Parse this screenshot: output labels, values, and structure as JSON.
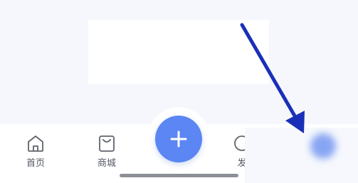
{
  "tabs": [
    {
      "label": "首页",
      "icon": "home-icon"
    },
    {
      "label": "商城",
      "icon": "shopping-bag-icon"
    },
    {
      "label": "发",
      "icon": "circle-icon"
    }
  ],
  "fab": {
    "icon": "plus-icon",
    "color": "#5b86f3"
  },
  "annotation": {
    "arrow_color": "#1a2fb8"
  }
}
